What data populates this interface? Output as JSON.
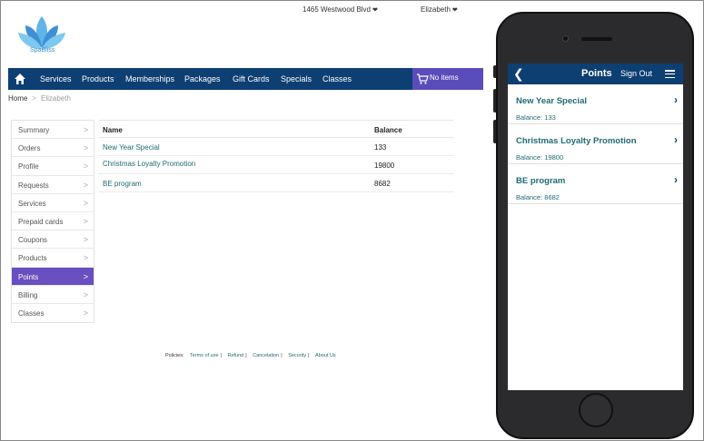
{
  "brand": {
    "name": "SpaBliss"
  },
  "topbar": {
    "location": "1465 Westwood Blvd",
    "user": "Elizabeth",
    "caret": "❤"
  },
  "nav": {
    "items": [
      "Services",
      "Products",
      "Memberships",
      "Packages",
      "Gift Cards",
      "Specials",
      "Classes"
    ],
    "cart_label": "No items"
  },
  "breadcrumb": {
    "home": "Home",
    "separator": ">",
    "current": "Elizabeth"
  },
  "sidebar": {
    "items": [
      "Summary",
      "Orders",
      "Profile",
      "Requests",
      "Services",
      "Prepaid cards",
      "Coupons",
      "Products",
      "Points",
      "Billing",
      "Classes"
    ],
    "active_index": 8,
    "chevron": ">"
  },
  "table": {
    "headers": {
      "name": "Name",
      "balance": "Balance"
    },
    "rows": [
      {
        "name": "New Year Special",
        "balance": "133"
      },
      {
        "name": "Christmas Loyalty Promotion",
        "balance": "19800"
      },
      {
        "name": "BE program",
        "balance": "8682"
      }
    ]
  },
  "footer": {
    "prefix": "Policies:",
    "links": [
      "Terms of use",
      "Refund",
      "Cancelation",
      "Security",
      "About Us"
    ],
    "separator": "|"
  },
  "mobile": {
    "title": "Points",
    "signout": "Sign Out",
    "back": "❮",
    "chevron": "›",
    "items": [
      {
        "name": "New Year Special",
        "balance": "Balance: 133"
      },
      {
        "name": "Christmas Loyalty Promotion",
        "balance": "Balance: 19800"
      },
      {
        "name": "BE program",
        "balance": "Balance: 8682"
      }
    ]
  },
  "colors": {
    "nav": "#0d3f73",
    "accent": "#6a4fc0",
    "cart": "#5b4cbb",
    "link": "#1f6b73"
  }
}
